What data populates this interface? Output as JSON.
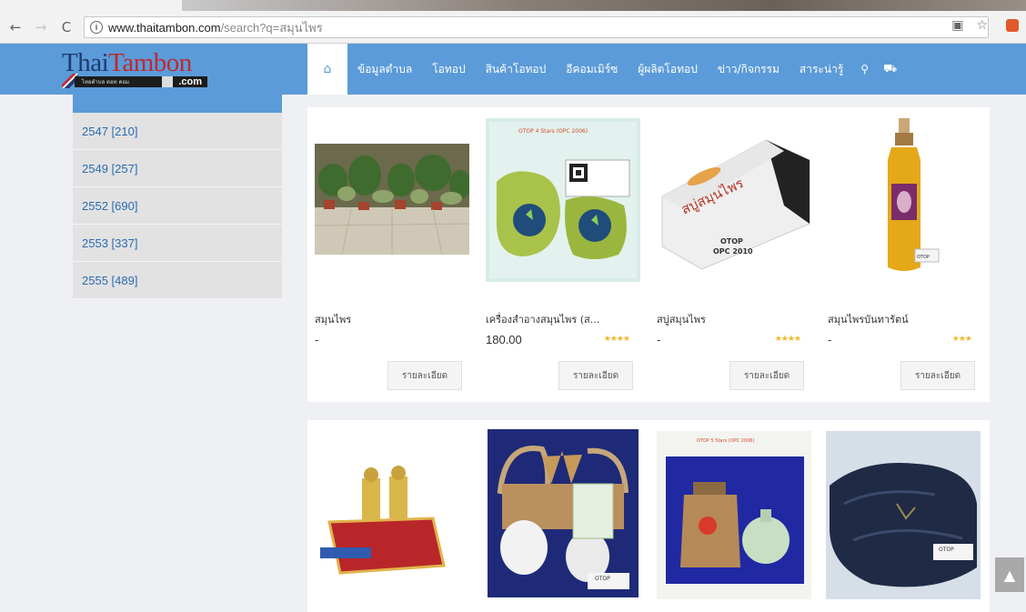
{
  "browser": {
    "url_host": "www.thaitambon.com",
    "url_path": "/search?q=สมุนไพร",
    "icons": [
      "back-arrow-icon",
      "forward-arrow-icon",
      "reload-icon",
      "info-icon",
      "translate-icon",
      "star-icon"
    ]
  },
  "site": {
    "logo_word1": "Thai",
    "logo_word2": "Tambon",
    "logo_tagline": "ไทยตำบล ดอท คอม",
    "logo_domain": ".com",
    "brand_blue": "#5b9bd9",
    "nav": [
      "ข้อมูลตำบล",
      "โอทอป",
      "สินค้าโอทอป",
      "อีคอมเมิร์ซ",
      "ผู้ผลิตโอทอป",
      "ข่าว/กิจกรรม",
      "สาระน่ารู้"
    ]
  },
  "sidebar": {
    "years": [
      "2547 [210]",
      "2549 [257]",
      "2552 [690]",
      "2553 [337]",
      "2555 [489]"
    ]
  },
  "products": [
    {
      "name": "สมุนไพร",
      "price": "-",
      "stars": "",
      "rating": 0,
      "detail_label": "รายละเอียด"
    },
    {
      "name": "เครื่องสำอางสมุนไพร (ส...",
      "price": "180.00",
      "stars": "★★★★",
      "rating": 4,
      "detail_label": "รายละเอียด"
    },
    {
      "name": "สบู่สมุนไพร",
      "price": "-",
      "stars": "★★★★",
      "rating": 4,
      "detail_label": "รายละเอียด"
    },
    {
      "name": "สมุนไพรบันทารัตน์",
      "price": "-",
      "stars": "★★★",
      "rating": 3,
      "detail_label": "รายละเอียด"
    }
  ],
  "image_labels": {
    "otop": "OTOP",
    "opc2010": "OPC 2010",
    "otop_stars": "OTOP 4 Stars (OPC 2006)",
    "soap_text": "สบู่สมุนไพร",
    "otop_stars5": "OTOP 5 Stars (OPC 2006)"
  },
  "back_to_top_icon": "arrow-up-icon"
}
